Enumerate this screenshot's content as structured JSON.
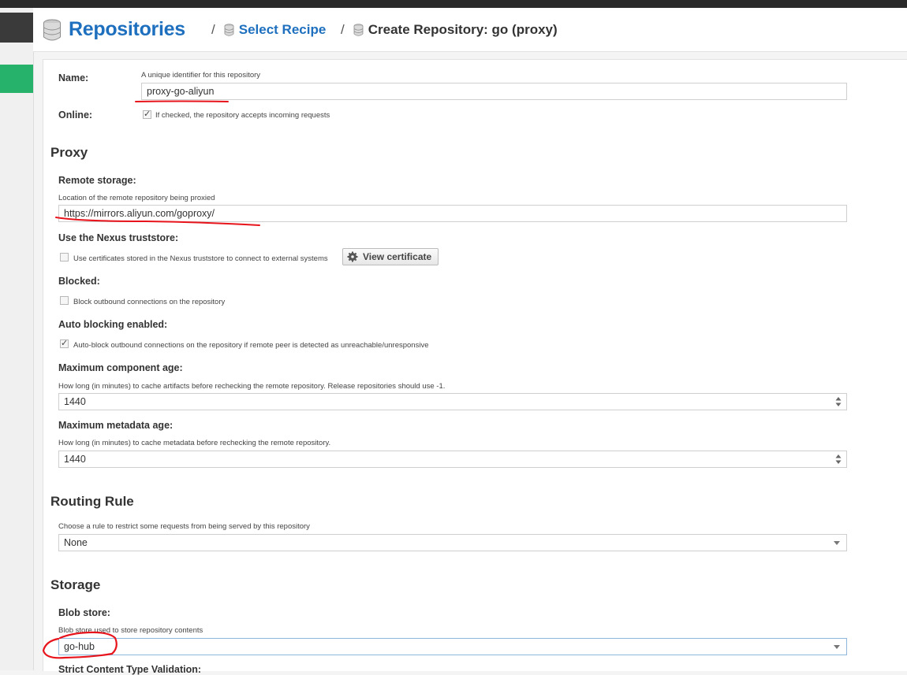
{
  "breadcrumb": {
    "root": "Repositories",
    "separator": "/",
    "recipe": "Select Recipe",
    "current": "Create Repository: go (proxy)"
  },
  "name": {
    "label": "Name:",
    "help": "A unique identifier for this repository",
    "value": "proxy-go-aliyun"
  },
  "online": {
    "label": "Online:",
    "checked": true,
    "help": "If checked, the repository accepts incoming requests"
  },
  "proxy": {
    "section": "Proxy",
    "remote_label": "Remote storage:",
    "remote_help": "Location of the remote repository being proxied",
    "remote_value": "https://mirrors.aliyun.com/goproxy/",
    "truststore_label": "Use the Nexus truststore:",
    "truststore_help": "Use certificates stored in the Nexus truststore to connect to external systems",
    "truststore_checked": false,
    "view_cert": "View certificate",
    "blocked_label": "Blocked:",
    "blocked_help": "Block outbound connections on the repository",
    "blocked_checked": false,
    "auto_label": "Auto blocking enabled:",
    "auto_help": "Auto-block outbound connections on the repository if remote peer is detected as unreachable/unresponsive",
    "auto_checked": true,
    "max_component_label": "Maximum component age:",
    "max_component_help": "How long (in minutes) to cache artifacts before rechecking the remote repository. Release repositories should use -1.",
    "max_component_value": "1440",
    "max_metadata_label": "Maximum metadata age:",
    "max_metadata_help": "How long (in minutes) to cache metadata before rechecking the remote repository.",
    "max_metadata_value": "1440"
  },
  "routing": {
    "section": "Routing Rule",
    "help": "Choose a rule to restrict some requests from being served by this repository",
    "value": "None"
  },
  "storage": {
    "section": "Storage",
    "blob_label": "Blob store:",
    "blob_help": "Blob store used to store repository contents",
    "blob_value": "go-hub",
    "strict_label": "Strict Content Type Validation:"
  },
  "colors": {
    "accent": "#1e70bf",
    "annotation": "#e8141c",
    "nav_active": "#26b26b"
  }
}
